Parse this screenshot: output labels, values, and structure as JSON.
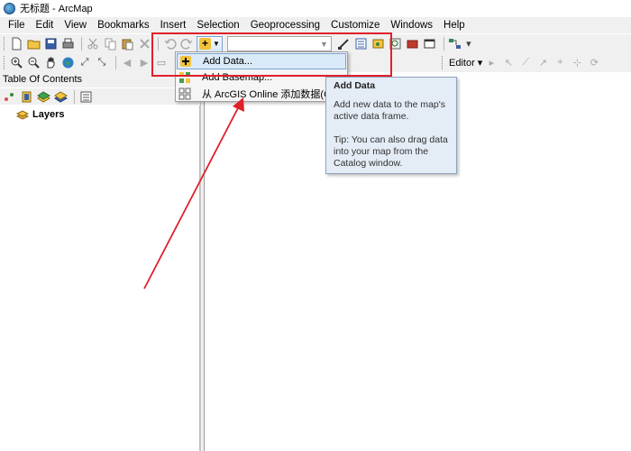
{
  "window": {
    "title": "无标题 - ArcMap"
  },
  "menu": [
    "File",
    "Edit",
    "View",
    "Bookmarks",
    "Insert",
    "Selection",
    "Geoprocessing",
    "Customize",
    "Windows",
    "Help"
  ],
  "toolbar": {
    "editor_label": "Editor ▾"
  },
  "toc": {
    "title": "Table Of Contents",
    "layers_label": "Layers"
  },
  "add_data_menu": {
    "items": [
      {
        "label": "Add Data...",
        "icon": "add-data-icon",
        "highlighted": true
      },
      {
        "label": "Add Basemap...",
        "icon": "basemap-icon",
        "highlighted": false
      },
      {
        "label": "从 ArcGIS Online 添加数据(O)...",
        "icon": "arcgis-online-icon",
        "highlighted": false
      }
    ]
  },
  "tooltip": {
    "title": "Add Data",
    "body": "Add new data to the map's active data frame.",
    "tip": "Tip: You can also drag data into your map from the Catalog window."
  },
  "colors": {
    "annotation_red": "#e0202a",
    "highlight_blue": "#dbeaf8",
    "tooltip_bg": "#e4ecf5"
  }
}
